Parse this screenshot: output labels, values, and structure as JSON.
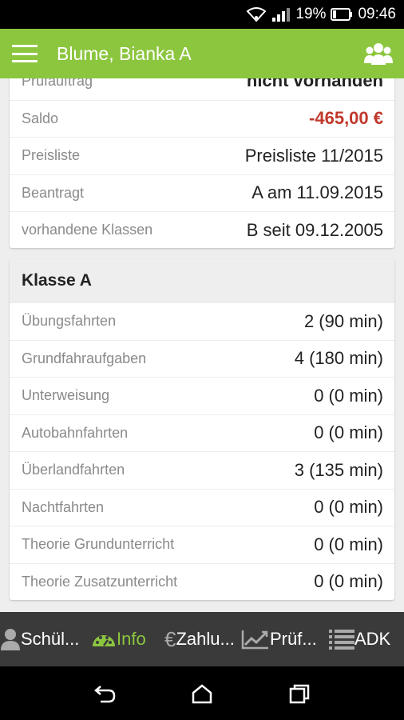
{
  "status_bar": {
    "battery": "19%",
    "time": "09:46"
  },
  "app_bar": {
    "title": "Blume, Bianka A"
  },
  "info_rows": [
    {
      "label": "Prüfauftrag",
      "value": "nicht vorhanden"
    },
    {
      "label": "Saldo",
      "value": "-465,00 €"
    },
    {
      "label": "Preisliste",
      "value": "Preisliste 11/2015"
    },
    {
      "label": "Beantragt",
      "value": "A am 11.09.2015"
    },
    {
      "label": "vorhandene Klassen",
      "value": "B seit 09.12.2005"
    }
  ],
  "klasse": {
    "title": "Klasse A",
    "rows": [
      {
        "label": "Übungsfahrten",
        "value": "2 (90 min)"
      },
      {
        "label": "Grundfahraufgaben",
        "value": "4 (180 min)"
      },
      {
        "label": "Unterweisung",
        "value": "0 (0 min)"
      },
      {
        "label": "Autobahnfahrten",
        "value": "0 (0 min)"
      },
      {
        "label": "Überlandfahrten",
        "value": "3 (135 min)"
      },
      {
        "label": "Nachtfahrten",
        "value": "0 (0 min)"
      },
      {
        "label": "Theorie Grundunterricht",
        "value": "0 (0 min)"
      },
      {
        "label": "Theorie Zusatzunterricht",
        "value": "0 (0 min)"
      }
    ]
  },
  "bottom_nav": [
    {
      "label": "Schül...",
      "icon": "person-icon"
    },
    {
      "label": "Info",
      "icon": "speedometer-icon",
      "active": true
    },
    {
      "label": "Zahlu...",
      "icon": "euro-icon"
    },
    {
      "label": "Prüf...",
      "icon": "trend-chart-icon"
    },
    {
      "label": "ADK",
      "icon": "list-icon"
    }
  ],
  "colors": {
    "accent": "#8cc63f",
    "negative": "#c0392b"
  }
}
